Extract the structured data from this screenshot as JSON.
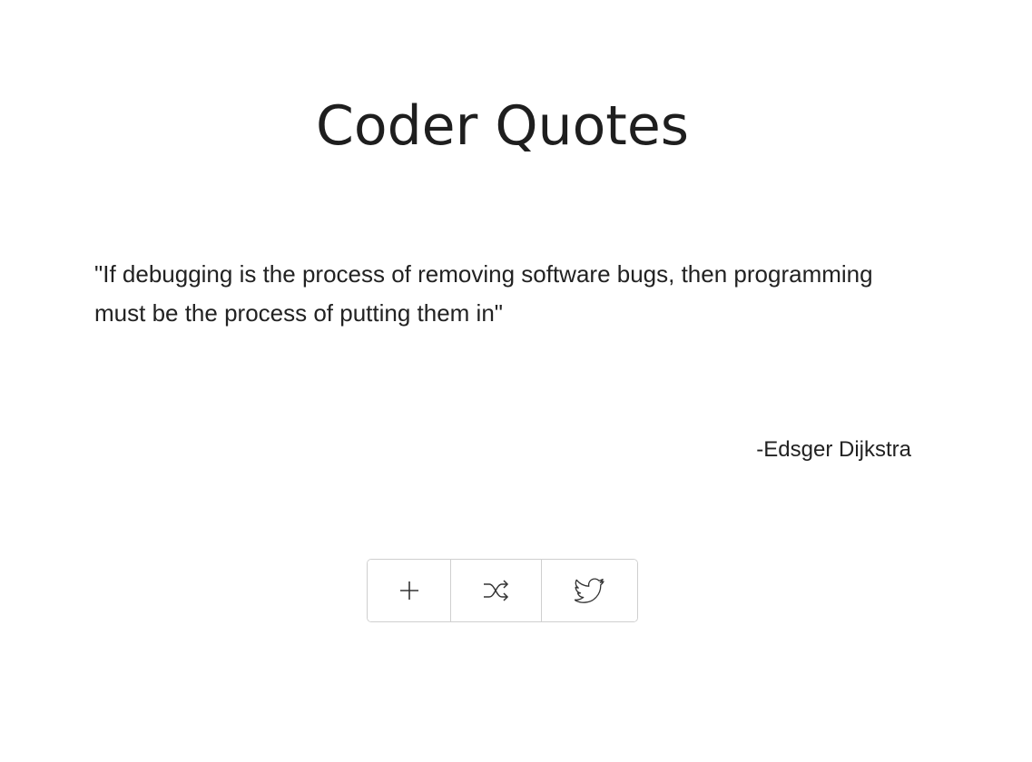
{
  "app": {
    "title": "Coder Quotes"
  },
  "quote": {
    "text": "\"If debugging is the process of removing software bugs, then programming must be the process of putting them in\"",
    "author": "-Edsger Dijkstra"
  },
  "toolbar": {
    "buttons": [
      {
        "action": "add",
        "icon": "plus-icon"
      },
      {
        "action": "shuffle",
        "icon": "shuffle-icon"
      },
      {
        "action": "tweet",
        "icon": "twitter-icon"
      }
    ]
  },
  "colors": {
    "text": "#222222",
    "border": "#cfcfcf",
    "background": "#ffffff"
  }
}
